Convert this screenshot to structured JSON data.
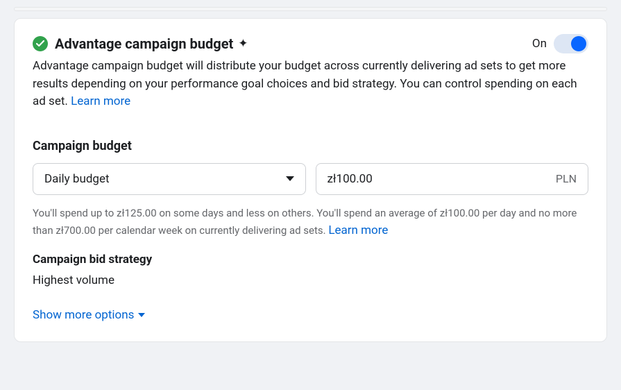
{
  "header": {
    "title": "Advantage campaign budget",
    "toggle_label": "On"
  },
  "description": {
    "text": "Advantage campaign budget will distribute your budget across currently delivering ad sets to get more results depending on your performance goal choices and bid strategy. You can control spending on each ad set.",
    "learn_more": "Learn more"
  },
  "budget": {
    "section_label": "Campaign budget",
    "type_label": "Daily budget",
    "amount_value": "zł100.00",
    "currency": "PLN",
    "help_text": "You'll spend up to zł125.00 on some days and less on others. You'll spend an average of zł100.00 per day and no more than zł700.00 per calendar week on currently delivering ad sets.",
    "help_learn_more": "Learn more"
  },
  "bid_strategy": {
    "label": "Campaign bid strategy",
    "value": "Highest volume"
  },
  "footer": {
    "show_more": "Show more options"
  }
}
